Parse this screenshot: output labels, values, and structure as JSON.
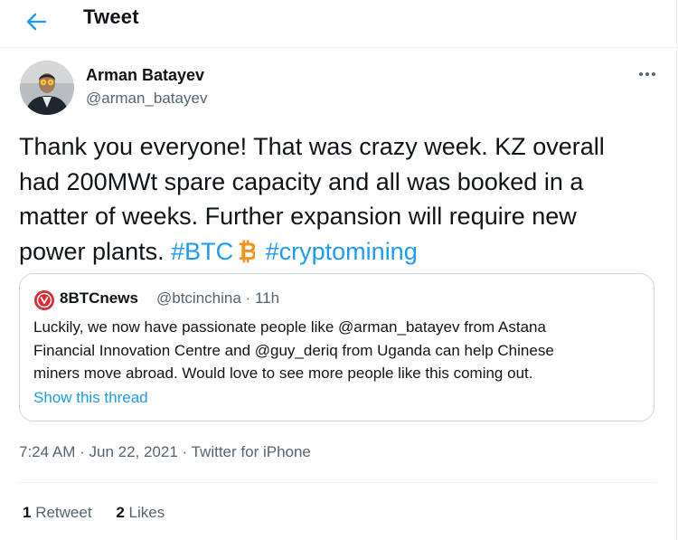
{
  "header": {
    "title": "Tweet",
    "back_icon": "arrow-left-icon"
  },
  "author": {
    "name": "Arman Batayev",
    "handle": "@arman_batayev"
  },
  "more_icon": "more-horizontal-icon",
  "tweet": {
    "line1": "Thank you everyone! That was crazy week. KZ overall",
    "line2": "had 200MWt spare capacity and all was booked in a",
    "line3": "matter of weeks. Further expansion will require new",
    "line4_text": "power plants. ",
    "hashtag1": "#BTC",
    "btc_icon": "bitcoin-icon",
    "hashtag2": "#cryptomining"
  },
  "quote": {
    "name": "8BTCnews",
    "handle": "@btcinchina",
    "separator": "·",
    "time": "11h",
    "line1": "Luckily, we now have passionate people like @arman_batayev from Astana",
    "line2": "Financial Innovation Centre and @guy_deriq from Uganda can help Chinese",
    "line3": "miners move abroad. Would love to see more people like this coming out.",
    "show_thread": "Show this thread"
  },
  "meta": {
    "time": "7:24 AM",
    "sep": " · ",
    "date": "Jun 22, 2021",
    "source": "Twitter for iPhone"
  },
  "stats": {
    "retweets_count": "1",
    "retweets_label": "Retweet",
    "likes_count": "2",
    "likes_label": "Likes"
  },
  "colors": {
    "accent": "#1d9bf0",
    "btc_orange": "#f7931a",
    "text": "#0f1419",
    "muted": "#536471",
    "border": "#cfd9de"
  }
}
